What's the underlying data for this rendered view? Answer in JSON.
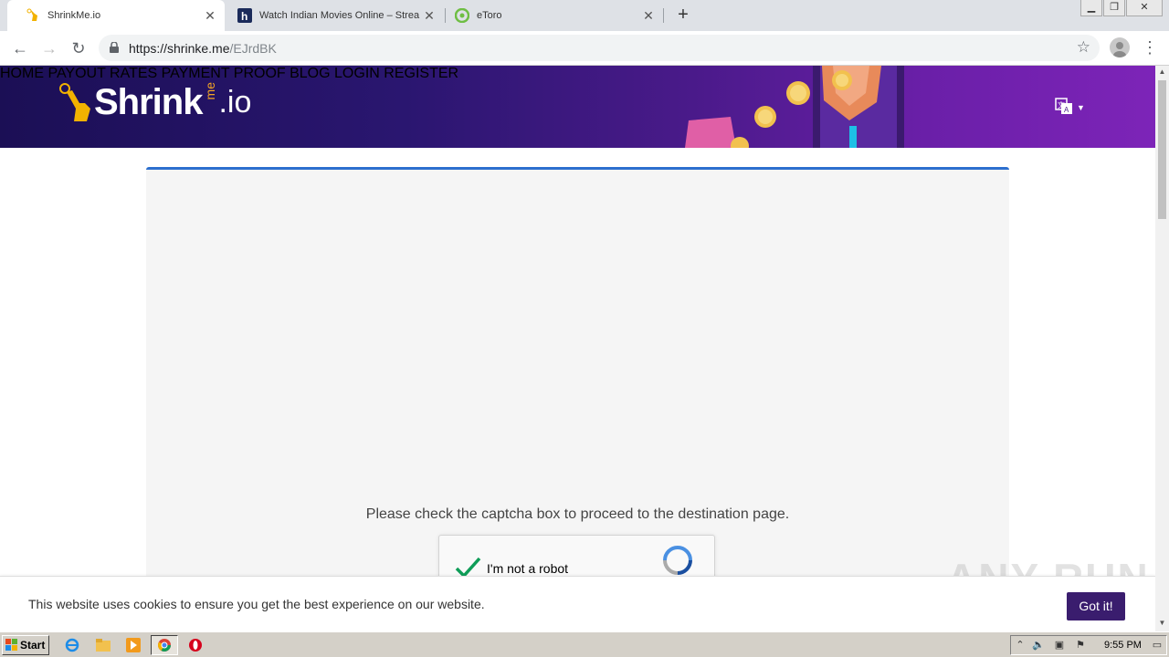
{
  "browser": {
    "tabs": [
      {
        "label": "ShrinkMe.io",
        "active": true
      },
      {
        "label": "Watch Indian Movies Online – Strea",
        "active": false
      },
      {
        "label": "eToro",
        "active": false
      }
    ],
    "url_host": "https://shrinke.me",
    "url_path": "/EJrdBK"
  },
  "site": {
    "brand": "Shrink",
    "brand_me": "me",
    "brand_io": ".io",
    "nav": [
      "HOME",
      "PAYOUT RATES",
      "PAYMENT PROOF",
      "BLOG",
      "LOGIN",
      "REGISTER"
    ],
    "colors": {
      "header_start": "#1b0f55",
      "header_end": "#7d24b8",
      "accent": "#2c6fce",
      "cookie_button": "#3a1d6e"
    }
  },
  "main": {
    "captcha_message": "Please check the captcha box to proceed to the destination page.",
    "recaptcha_label": "I'm not a robot",
    "recaptcha_checked": true
  },
  "cookie": {
    "message": "This website uses cookies to ensure you get the best experience on our website.",
    "button": "Got it!"
  },
  "watermark": "ANY RUN",
  "taskbar": {
    "start": "Start",
    "clock": "9:55 PM"
  }
}
